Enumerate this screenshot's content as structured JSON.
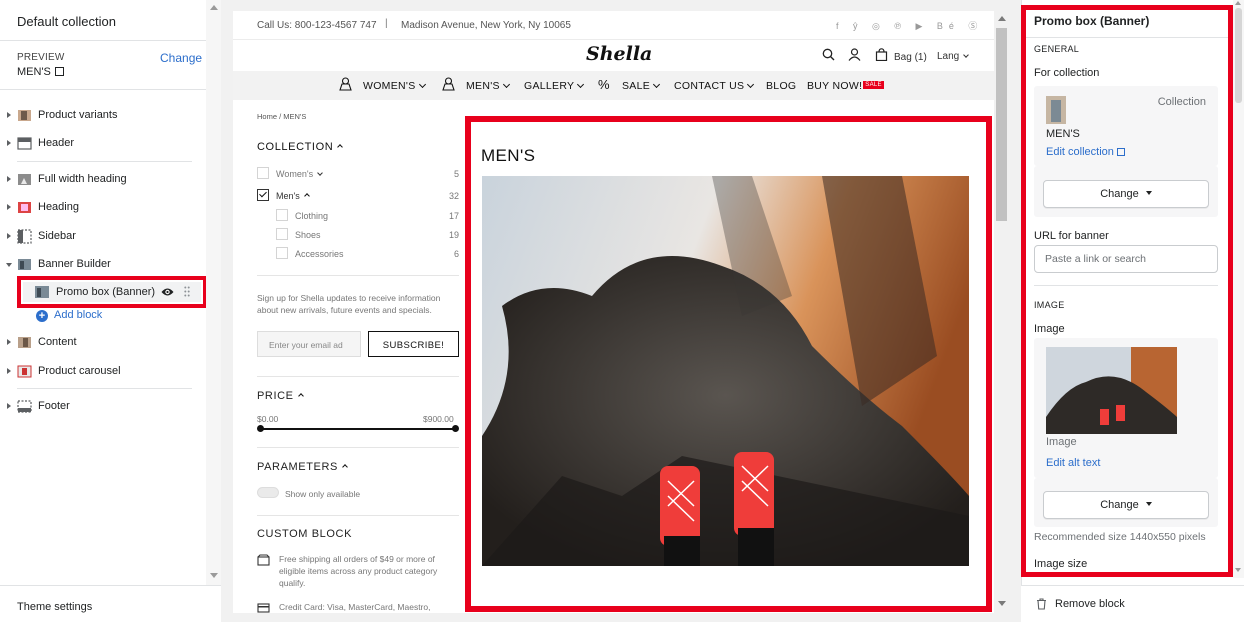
{
  "left": {
    "title": "Default collection",
    "preview_label": "PREVIEW",
    "preview_change": "Change",
    "preview_value": "MEN'S",
    "sections": [
      {
        "label": "Product variants"
      },
      {
        "label": "Header"
      },
      {
        "label": "Full width heading"
      },
      {
        "label": "Heading"
      },
      {
        "label": "Sidebar"
      },
      {
        "label": "Banner Builder"
      },
      {
        "label": "Content"
      },
      {
        "label": "Product carousel"
      },
      {
        "label": "Footer"
      }
    ],
    "block_label": "Promo box (Banner)",
    "add_block": "Add block",
    "theme_settings": "Theme settings"
  },
  "preview": {
    "phone": "Call Us: 800-123-4567 747",
    "separator": "|",
    "address": "Madison Avenue, New York, Ny 10065",
    "social": "f ŷ ◎ ℗ ▶ Bé Ⓢ",
    "logo": "Shella",
    "bag": "Bag (1)",
    "lang": "Lang",
    "menu": {
      "womens": "WOMEN'S",
      "mens": "MEN'S",
      "gallery": "GALLERY",
      "sale": "SALE",
      "contact": "CONTACT US",
      "blog": "BLOG",
      "buy": "BUY NOW!",
      "sale_badge": "SALE"
    },
    "breadcrumb": "Home  /  MEN'S",
    "collection_heading": "COLLECTION",
    "filters": [
      {
        "label": "Women's",
        "count": "5"
      },
      {
        "label": "Men's",
        "count": "32"
      },
      {
        "label": "Clothing",
        "count": "17"
      },
      {
        "label": "Shoes",
        "count": "19"
      },
      {
        "label": "Accessories",
        "count": "6"
      }
    ],
    "signup_text": "Sign up for Shella updates to receive information about new arrivals, future events and specials.",
    "email_placeholder": "Enter your email ad",
    "subscribe": "SUBSCRIBE!",
    "price_heading": "PRICE",
    "price_min": "$0.00",
    "price_max": "$900.00",
    "params_heading": "PARAMETERS",
    "show_available": "Show only available",
    "custom_heading": "CUSTOM BLOCK",
    "custom_1": "Free shipping all orders of $49 or more of eligible items across any product category qualify.",
    "custom_2": "Credit Card: Visa, MasterCard, Maestro,",
    "banner_title": "MEN'S"
  },
  "right": {
    "title": "Promo box (Banner)",
    "general": "GENERAL",
    "for_collection": "For collection",
    "collection_type": "Collection",
    "collection_name": "MEN'S",
    "edit_collection": "Edit collection",
    "change": "Change",
    "url_label": "URL for banner",
    "url_placeholder": "Paste a link or search",
    "image_section": "IMAGE",
    "image_label": "Image",
    "image_caption": "Image",
    "edit_alt": "Edit alt text",
    "change2": "Change",
    "recommended": "Recommended size 1440x550 pixels",
    "image_size": "Image size",
    "remove_block": "Remove block"
  },
  "colors": {
    "highlight": "#e8001c",
    "link": "#2c6ecb"
  }
}
